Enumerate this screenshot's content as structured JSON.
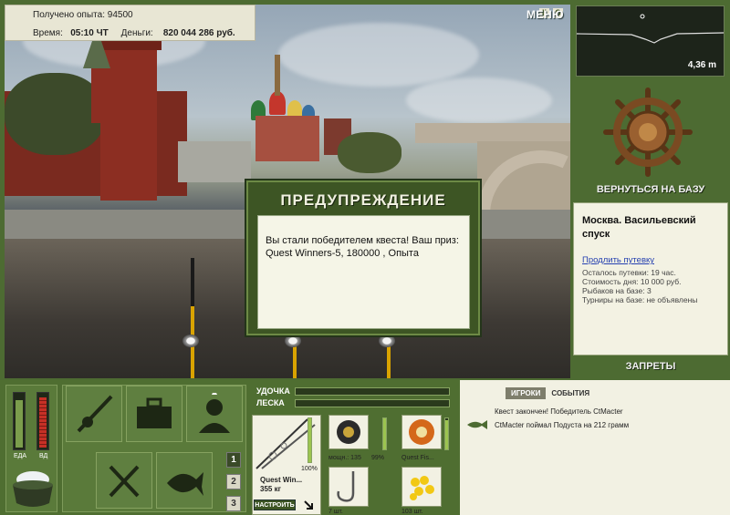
{
  "header": {
    "exp_label": "Получено опыта:",
    "exp_value": "94500",
    "time_label": "Время:",
    "time_value": "05:10 ЧТ",
    "money_label": "Деньги:",
    "money_value": "820 044 286 руб.",
    "menu_label": "МЕНЮ",
    "pause_icon": "pause-icon",
    "sound_icon": "sound-icon"
  },
  "dialog": {
    "title": "ПРЕДУПРЕЖДЕНИЕ",
    "message": "Вы стали победителем квеста! Ваш приз: Quest Winners-5, 180000 , Опыта"
  },
  "depth": {
    "value": "4,36 m"
  },
  "sidebar": {
    "home_button": "ВЕРНУТЬСЯ НА БАЗУ",
    "location_title": "Москва. Васильевский спуск",
    "extend_link": "Продлить путевку",
    "trip_left": "Осталось путевки: 19 час.",
    "day_cost": "Стоимость дня: 10 000 руб.",
    "fishers": "Рыбаков на базе: 3",
    "tournaments": "Турниры на базе: не объявлены",
    "bans_button": "ЗАПРЕТЫ"
  },
  "status": {
    "food_label": "ЕДА",
    "drink_label": "ВД",
    "food_level": 0.9,
    "drink_level": 0.95
  },
  "slots": [
    "1",
    "2",
    "3"
  ],
  "gear": {
    "rod_label": "УДОЧКА",
    "line_label": "ЛЕСКА",
    "rod_name": "Quest Win...",
    "rod_weight": "355 кг",
    "rod_condition": "100%",
    "setup_button": "НАСТРОИТЬ",
    "reel_power": "мощн.: 135",
    "reel_condition": "99%",
    "line_name": "Quest Fis...",
    "hook_count": "7 шт.",
    "bait_count": "103 шт."
  },
  "events": {
    "tab_players": "ИГРОКИ",
    "tab_events": "СОБЫТИЯ",
    "line1": "Квест закончен! Победитель CtMacter",
    "line2": "CtMacter поймал Подуста на 212 грамм"
  }
}
